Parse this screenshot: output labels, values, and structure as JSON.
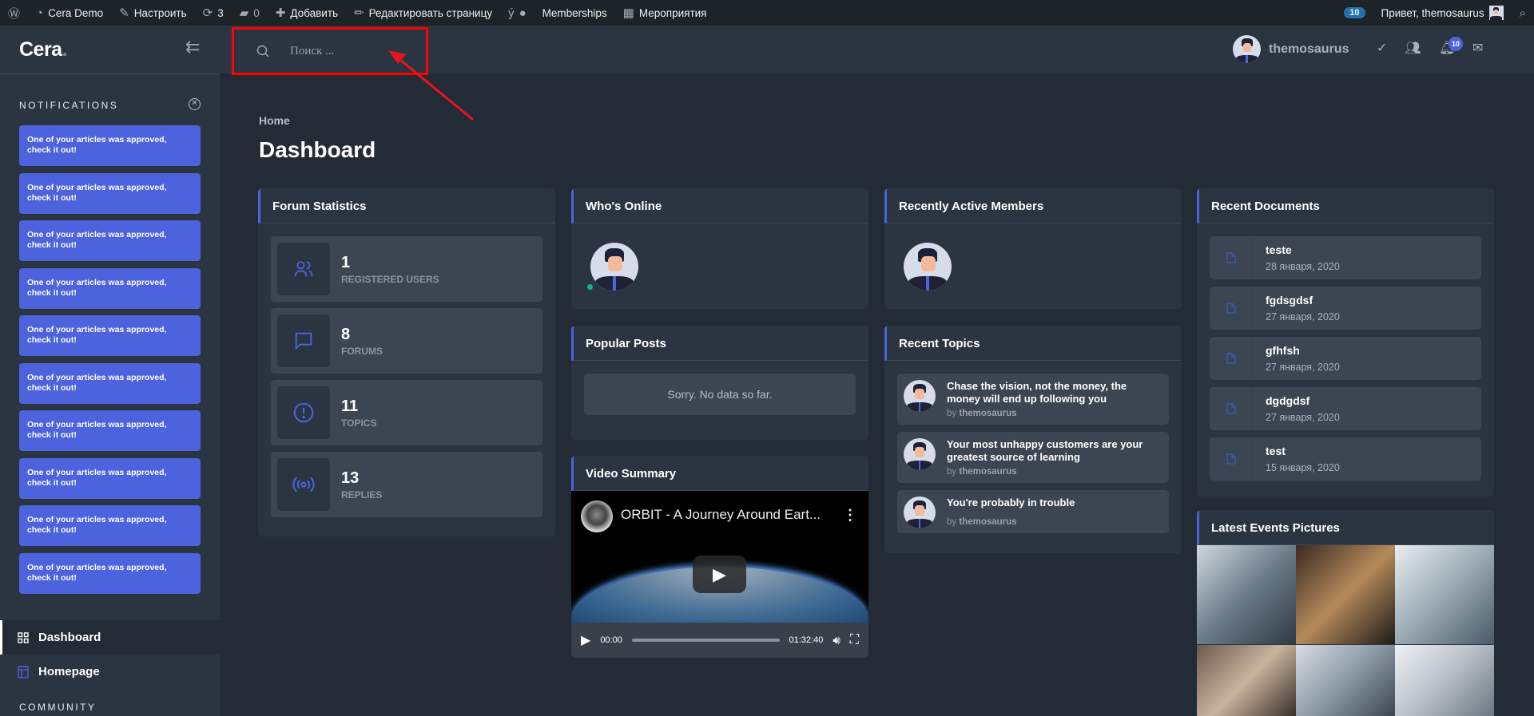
{
  "adminbar": {
    "site": "Cera Demo",
    "customize": "Настроить",
    "updates": "3",
    "comments": "0",
    "add": "Добавить",
    "edit_page": "Редактировать страницу",
    "memberships": "Memberships",
    "events": "Мероприятия",
    "notif_count": "10",
    "greeting": "Привет, themosaurus"
  },
  "sidebar": {
    "logo": "Cera",
    "notifications_title": "NOTIFICATIONS",
    "notifications": [
      "One of your articles was approved, check it out!",
      "One of your articles was approved, check it out!",
      "One of your articles was approved, check it out!",
      "One of your articles was approved, check it out!",
      "One of your articles was approved, check it out!",
      "One of your articles was approved, check it out!",
      "One of your articles was approved, check it out!",
      "One of your articles was approved, check it out!",
      "One of your articles was approved, check it out!",
      "One of your articles was approved, check it out!"
    ],
    "nav": [
      {
        "label": "Dashboard"
      },
      {
        "label": "Homepage"
      }
    ],
    "section": "COMMUNITY"
  },
  "header": {
    "search_placeholder": "Поиск ...",
    "username": "themosaurus",
    "notif_count": "10"
  },
  "page": {
    "breadcrumb": "Home",
    "title": "Dashboard"
  },
  "forum_stats": {
    "title": "Forum Statistics",
    "items": [
      {
        "value": "1",
        "label": "REGISTERED USERS"
      },
      {
        "value": "8",
        "label": "FORUMS"
      },
      {
        "value": "11",
        "label": "TOPICS"
      },
      {
        "value": "13",
        "label": "REPLIES"
      }
    ]
  },
  "whos_online": {
    "title": "Who's Online"
  },
  "popular_posts": {
    "title": "Popular Posts",
    "empty": "Sorry. No data so far."
  },
  "video": {
    "title": "Video Summary",
    "video_title": "ORBIT - A Journey Around Eart...",
    "current": "00:00",
    "duration": "01:32:40"
  },
  "recently_active": {
    "title": "Recently Active Members"
  },
  "recent_topics": {
    "title": "Recent Topics",
    "items": [
      {
        "title": "Chase the vision, not the money, the money will end up following you",
        "by": "by",
        "author": "themosaurus"
      },
      {
        "title": "Your most unhappy customers are your greatest source of learning",
        "by": "by",
        "author": "themosaurus"
      },
      {
        "title": "You're probably in trouble",
        "by": "by",
        "author": "themosaurus"
      }
    ]
  },
  "recent_documents": {
    "title": "Recent Documents",
    "items": [
      {
        "name": "teste",
        "date": "28 января, 2020"
      },
      {
        "name": "fgdsgdsf",
        "date": "27 января, 2020"
      },
      {
        "name": "gfhfsh",
        "date": "27 января, 2020"
      },
      {
        "name": "dgdgdsf",
        "date": "27 января, 2020"
      },
      {
        "name": "test",
        "date": "15 января, 2020"
      }
    ]
  },
  "events": {
    "title": "Latest Events Pictures"
  },
  "colors": {
    "accent": "#4c63dd",
    "bg": "#222b36",
    "panel": "#2b3542",
    "highlight": "#ff0000"
  }
}
